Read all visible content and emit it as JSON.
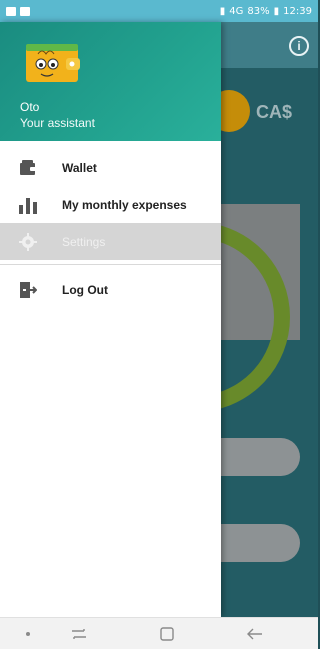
{
  "status_bar": {
    "battery_percent": "83%",
    "time": "12:39",
    "network": "4G"
  },
  "background": {
    "currency_label": "CA$",
    "info_icon": "info-icon"
  },
  "drawer": {
    "header": {
      "name": "Oto",
      "subtitle": "Your assistant",
      "avatar_icon": "wallet-face-icon",
      "gradient_color": "#22a28f"
    },
    "menu": [
      {
        "label": "Wallet",
        "icon": "wallet-icon",
        "enabled": true
      },
      {
        "label": "My monthly expenses",
        "icon": "bar-chart-icon",
        "enabled": true
      },
      {
        "label": "Settings",
        "icon": "gear-icon",
        "enabled": false
      }
    ],
    "secondary_menu": [
      {
        "label": "Log Out",
        "icon": "logout-icon",
        "enabled": true
      }
    ]
  },
  "nav_bar": {
    "items": [
      "dot-button",
      "recents-button",
      "home-button",
      "back-button"
    ]
  }
}
